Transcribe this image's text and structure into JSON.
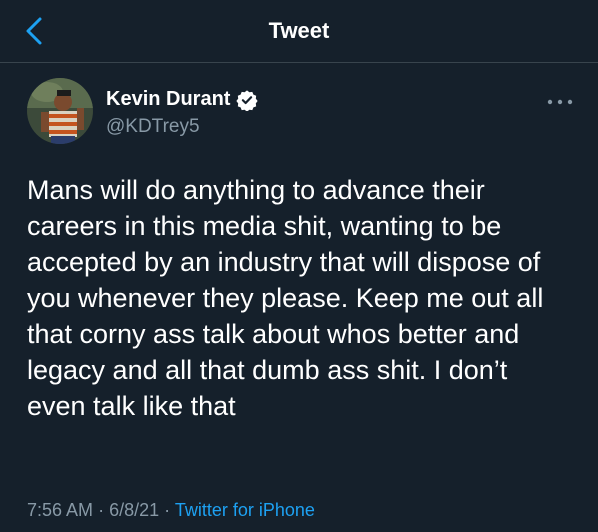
{
  "colors": {
    "background": "#15202b",
    "accent": "#1da1f2",
    "muted": "#8899a6",
    "divider": "#38444d"
  },
  "header": {
    "back_icon": "chevron-left-icon",
    "title": "Tweet"
  },
  "tweet": {
    "author": {
      "name": "Kevin Durant",
      "verified_icon": "verified-badge-icon",
      "handle": "@KDTrey5"
    },
    "more_icon": "more-options-icon",
    "text": "Mans will do anything to advance their\ncareers in this media shit, wanting to be\naccepted by an industry that will dispose of\nyou whenever they please. Keep me out all\nthat corny ass talk about whos better and\nlegacy and all that dumb ass shit. I don’t\neven talk like that",
    "time": "7:56 AM",
    "separator": "·",
    "date": "6/8/21",
    "source": "Twitter for iPhone"
  }
}
